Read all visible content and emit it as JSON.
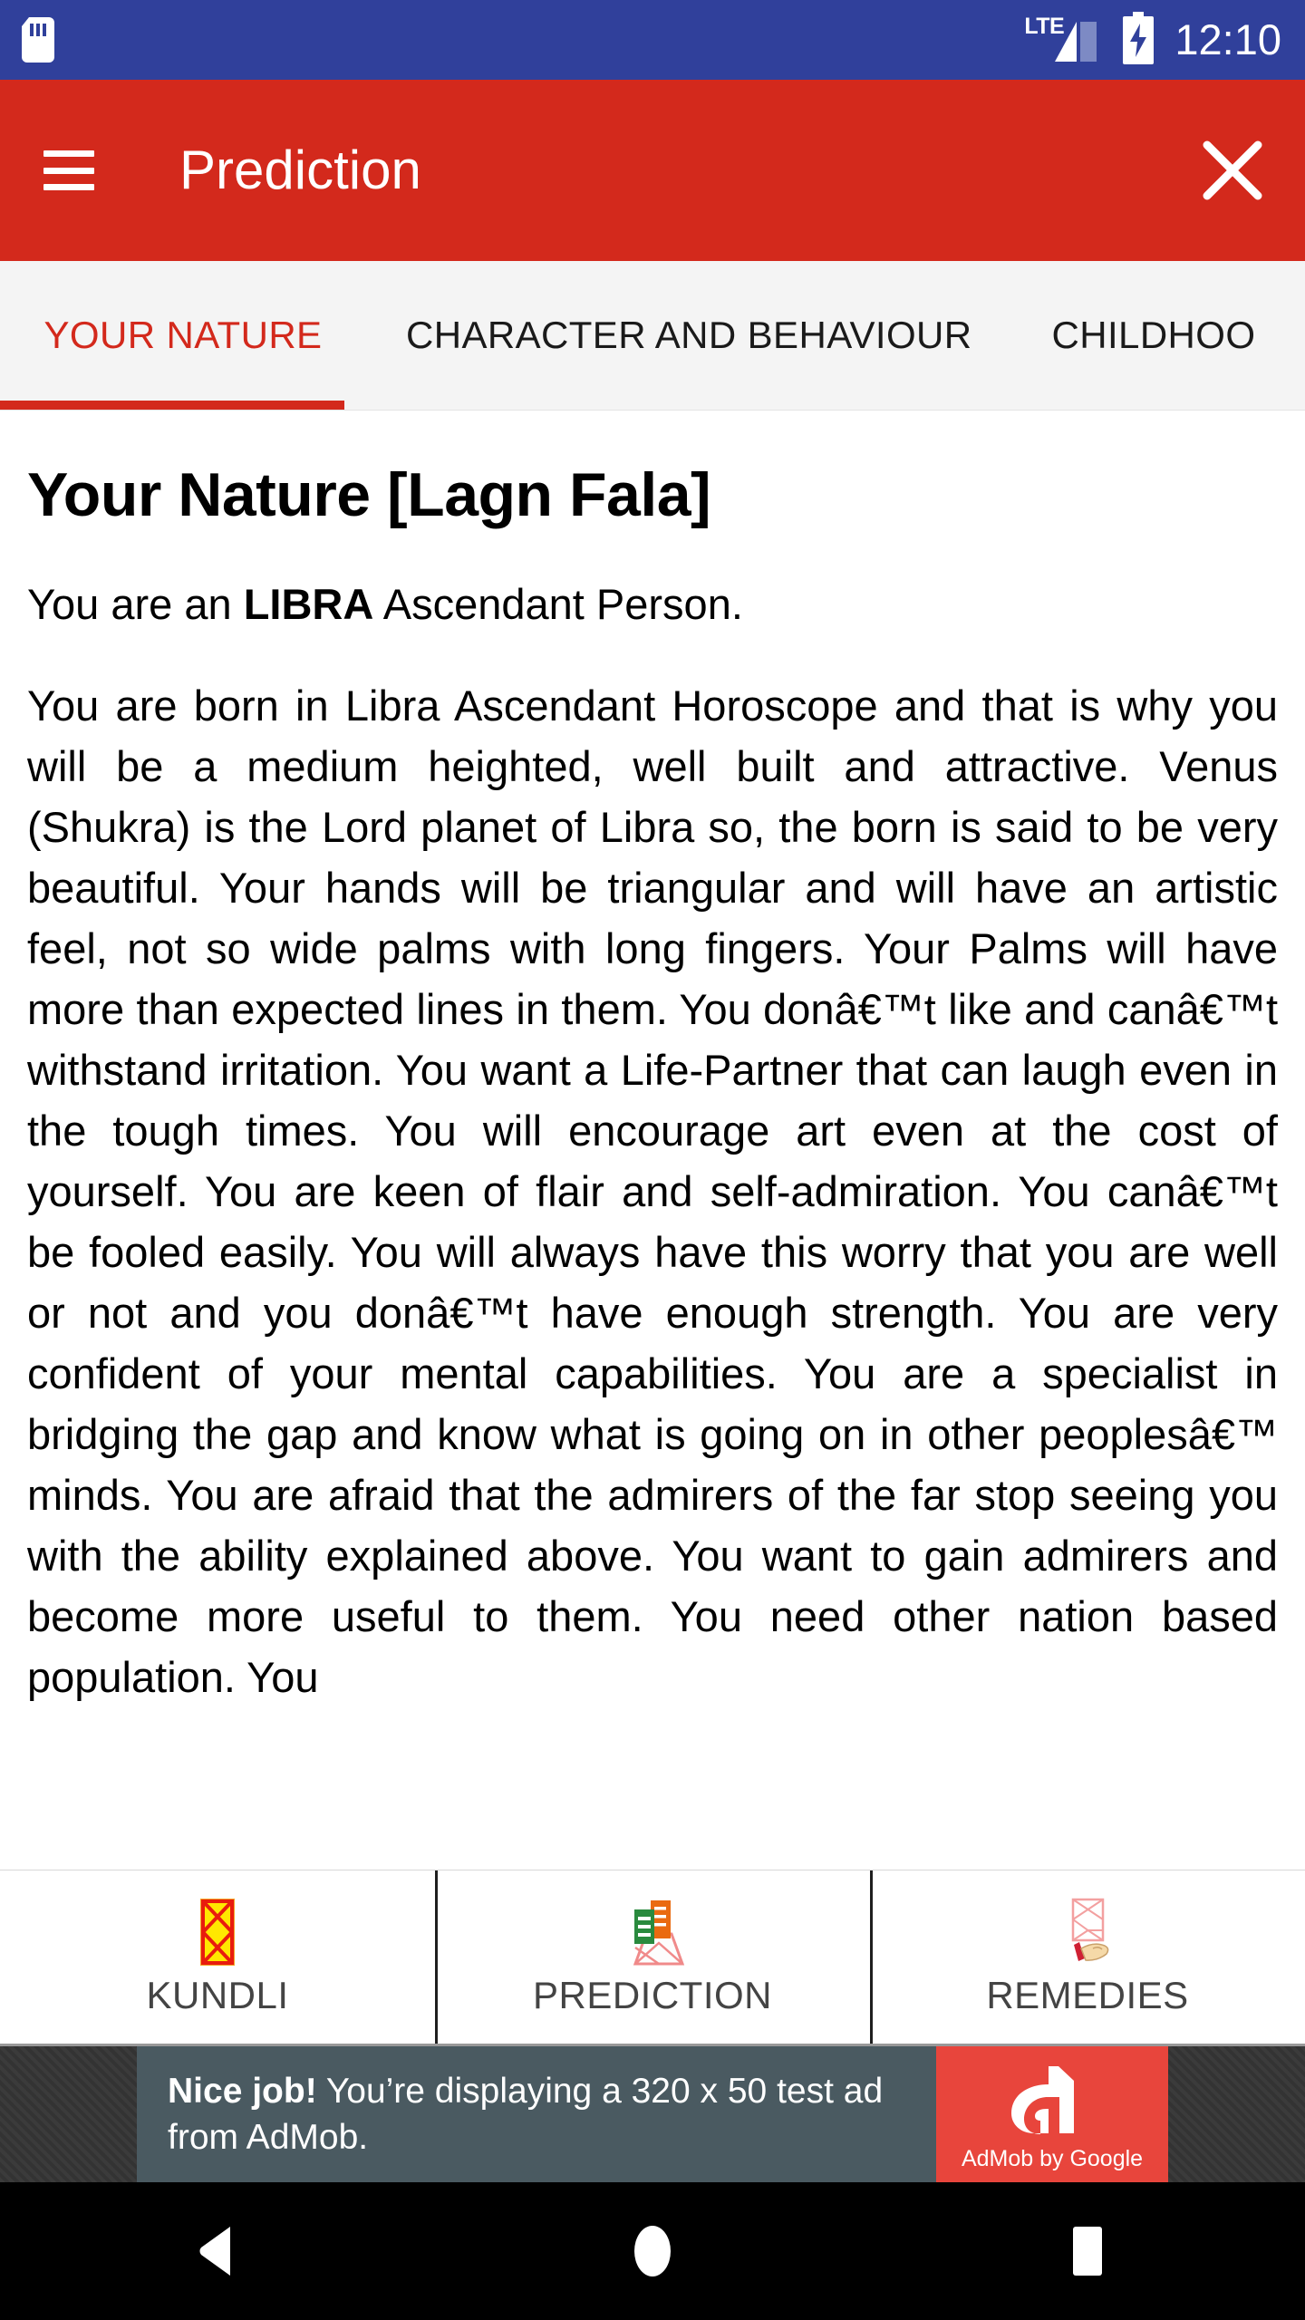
{
  "status_bar": {
    "sim_icon": "sim-card-icon",
    "network_label": "LTE",
    "signal_icon": "signal-bars-icon",
    "battery_icon": "battery-charging-icon",
    "time": "12:10",
    "background_color": "#30409b"
  },
  "app_bar": {
    "menu_icon": "hamburger-menu-icon",
    "title": "Prediction",
    "close_icon": "close-icon",
    "background_color": "#d3291c"
  },
  "tabs": {
    "active_index": 0,
    "items": [
      {
        "label": "YOUR NATURE"
      },
      {
        "label": "CHARACTER AND BEHAVIOUR"
      },
      {
        "label": "CHILDHOO"
      }
    ],
    "active_color": "#d3291c",
    "inactive_color": "#1a1a1a"
  },
  "content": {
    "heading": "Your Nature [Lagn Fala]",
    "lead_prefix": "You are an ",
    "lead_bold": "LIBRA",
    "lead_suffix": " Ascendant Person.",
    "body": "You are born in Libra Ascendant Horoscope and that is why you will be a medium heighted, well built and attractive. Venus (Shukra) is the Lord planet of Libra so, the born is said to be very beautiful. Your hands will be triangular and will have an artistic feel, not so wide palms with long fingers. Your Palms will have more than expected lines in them. You donâ€™t like and canâ€™t withstand irritation. You want a Life-Partner that can laugh even in the tough times. You will encourage art even at the cost of yourself. You are keen of flair and self-admiration. You canâ€™t be fooled easily. You will always have this worry that you are well or not and you donâ€™t have enough strength. You are very confident of your mental capabilities. You are a specialist in bridging the gap and know what is going on in other peoplesâ€™ minds. You are afraid that the admirers of the far stop seeing you with the ability explained above. You want to gain admirers and become more useful to them. You need other nation based population. You"
  },
  "bottom_nav": {
    "items": [
      {
        "label": "KUNDLI",
        "icon": "kundli-chart-icon"
      },
      {
        "label": "PREDICTION",
        "icon": "prediction-document-icon"
      },
      {
        "label": "REMEDIES",
        "icon": "remedies-hand-icon"
      }
    ]
  },
  "ad_banner": {
    "headline": "Nice job!",
    "message": " You’re displaying a 320 x 50 test ad from AdMob.",
    "logo_text": "AdMob by Google",
    "logo_icon": "admob-logo-icon",
    "logo_color": "#e8453c",
    "panel_color": "#4a5a61"
  },
  "system_nav": {
    "back_icon": "back-triangle-icon",
    "home_icon": "home-circle-icon",
    "recents_icon": "recents-square-icon"
  }
}
